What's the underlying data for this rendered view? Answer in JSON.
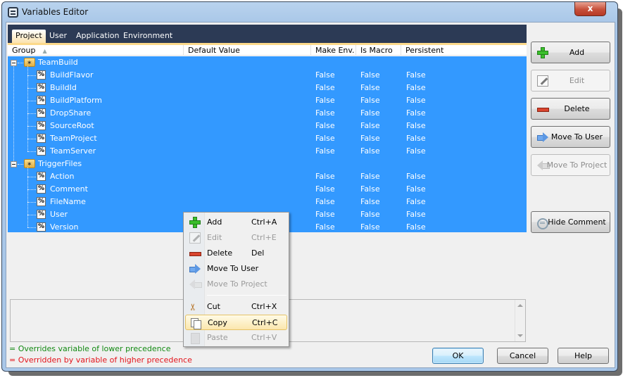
{
  "window": {
    "title": "Variables Editor",
    "close_label": "x"
  },
  "tabs": [
    {
      "label": "Project",
      "active": true
    },
    {
      "label": "User",
      "active": false
    },
    {
      "label": "Application",
      "active": false
    },
    {
      "label": "Environment",
      "active": false
    }
  ],
  "grid": {
    "columns": [
      "Group",
      "Default Value",
      "Make Env.",
      "Is Macro",
      "Persistent"
    ],
    "sort_column": "Group",
    "sort_direction": "ascending",
    "selection_color": "#3399ff",
    "groups": [
      {
        "name": "TeamBuild",
        "expanded": true,
        "variables": [
          {
            "name": "BuildFlavor",
            "default_value": "",
            "make_env": "False",
            "is_macro": "False",
            "persistent": "False"
          },
          {
            "name": "BuildId",
            "default_value": "",
            "make_env": "False",
            "is_macro": "False",
            "persistent": "False"
          },
          {
            "name": "BuildPlatform",
            "default_value": "",
            "make_env": "False",
            "is_macro": "False",
            "persistent": "False"
          },
          {
            "name": "DropShare",
            "default_value": "",
            "make_env": "False",
            "is_macro": "False",
            "persistent": "False"
          },
          {
            "name": "SourceRoot",
            "default_value": "",
            "make_env": "False",
            "is_macro": "False",
            "persistent": "False"
          },
          {
            "name": "TeamProject",
            "default_value": "",
            "make_env": "False",
            "is_macro": "False",
            "persistent": "False"
          },
          {
            "name": "TeamServer",
            "default_value": "",
            "make_env": "False",
            "is_macro": "False",
            "persistent": "False"
          }
        ]
      },
      {
        "name": "TriggerFiles",
        "expanded": true,
        "variables": [
          {
            "name": "Action",
            "default_value": "",
            "make_env": "False",
            "is_macro": "False",
            "persistent": "False"
          },
          {
            "name": "Comment",
            "default_value": "",
            "make_env": "False",
            "is_macro": "False",
            "persistent": "False"
          },
          {
            "name": "FileName",
            "default_value": "",
            "make_env": "False",
            "is_macro": "False",
            "persistent": "False"
          },
          {
            "name": "User",
            "default_value": "",
            "make_env": "False",
            "is_macro": "False",
            "persistent": "False"
          },
          {
            "name": "Version",
            "default_value": "",
            "make_env": "False",
            "is_macro": "False",
            "persistent": "False"
          }
        ]
      }
    ]
  },
  "side_buttons": {
    "add": {
      "label": "Add",
      "enabled": true
    },
    "edit": {
      "label": "Edit",
      "enabled": false
    },
    "delete": {
      "label": "Delete",
      "enabled": true
    },
    "move_to_user": {
      "label": "Move To User",
      "enabled": true
    },
    "move_to_project": {
      "label": "Move To Project",
      "enabled": false
    },
    "hide_comment": {
      "label": "Hide Comment",
      "enabled": true
    }
  },
  "context_menu": {
    "items": [
      {
        "label": "Add",
        "shortcut": "Ctrl+A",
        "enabled": true,
        "icon": "plus-icon"
      },
      {
        "label": "Edit",
        "shortcut": "Ctrl+E",
        "enabled": false,
        "icon": "edit-icon"
      },
      {
        "label": "Delete",
        "shortcut": "Del",
        "enabled": true,
        "icon": "minus-icon"
      },
      {
        "label": "Move To User",
        "shortcut": "",
        "enabled": true,
        "icon": "arrow-right-icon"
      },
      {
        "label": "Move To Project",
        "shortcut": "",
        "enabled": false,
        "icon": "arrow-left-icon"
      },
      {
        "label": "Cut",
        "shortcut": "Ctrl+X",
        "enabled": true,
        "icon": "scissors-icon"
      },
      {
        "label": "Copy",
        "shortcut": "Ctrl+C",
        "enabled": true,
        "highlighted": true,
        "icon": "copy-icon"
      },
      {
        "label": "Paste",
        "shortcut": "Ctrl+V",
        "enabled": false,
        "icon": "paste-icon"
      }
    ]
  },
  "comment": {
    "text": ""
  },
  "legend": {
    "overrides": "= Overrides variable of lower precedence",
    "overrides_color": "#138a13",
    "overridden": "= Overridden by variable of higher precedence",
    "overridden_color": "#e3141b"
  },
  "dialog_buttons": {
    "ok": "OK",
    "cancel": "Cancel",
    "help": "Help"
  }
}
